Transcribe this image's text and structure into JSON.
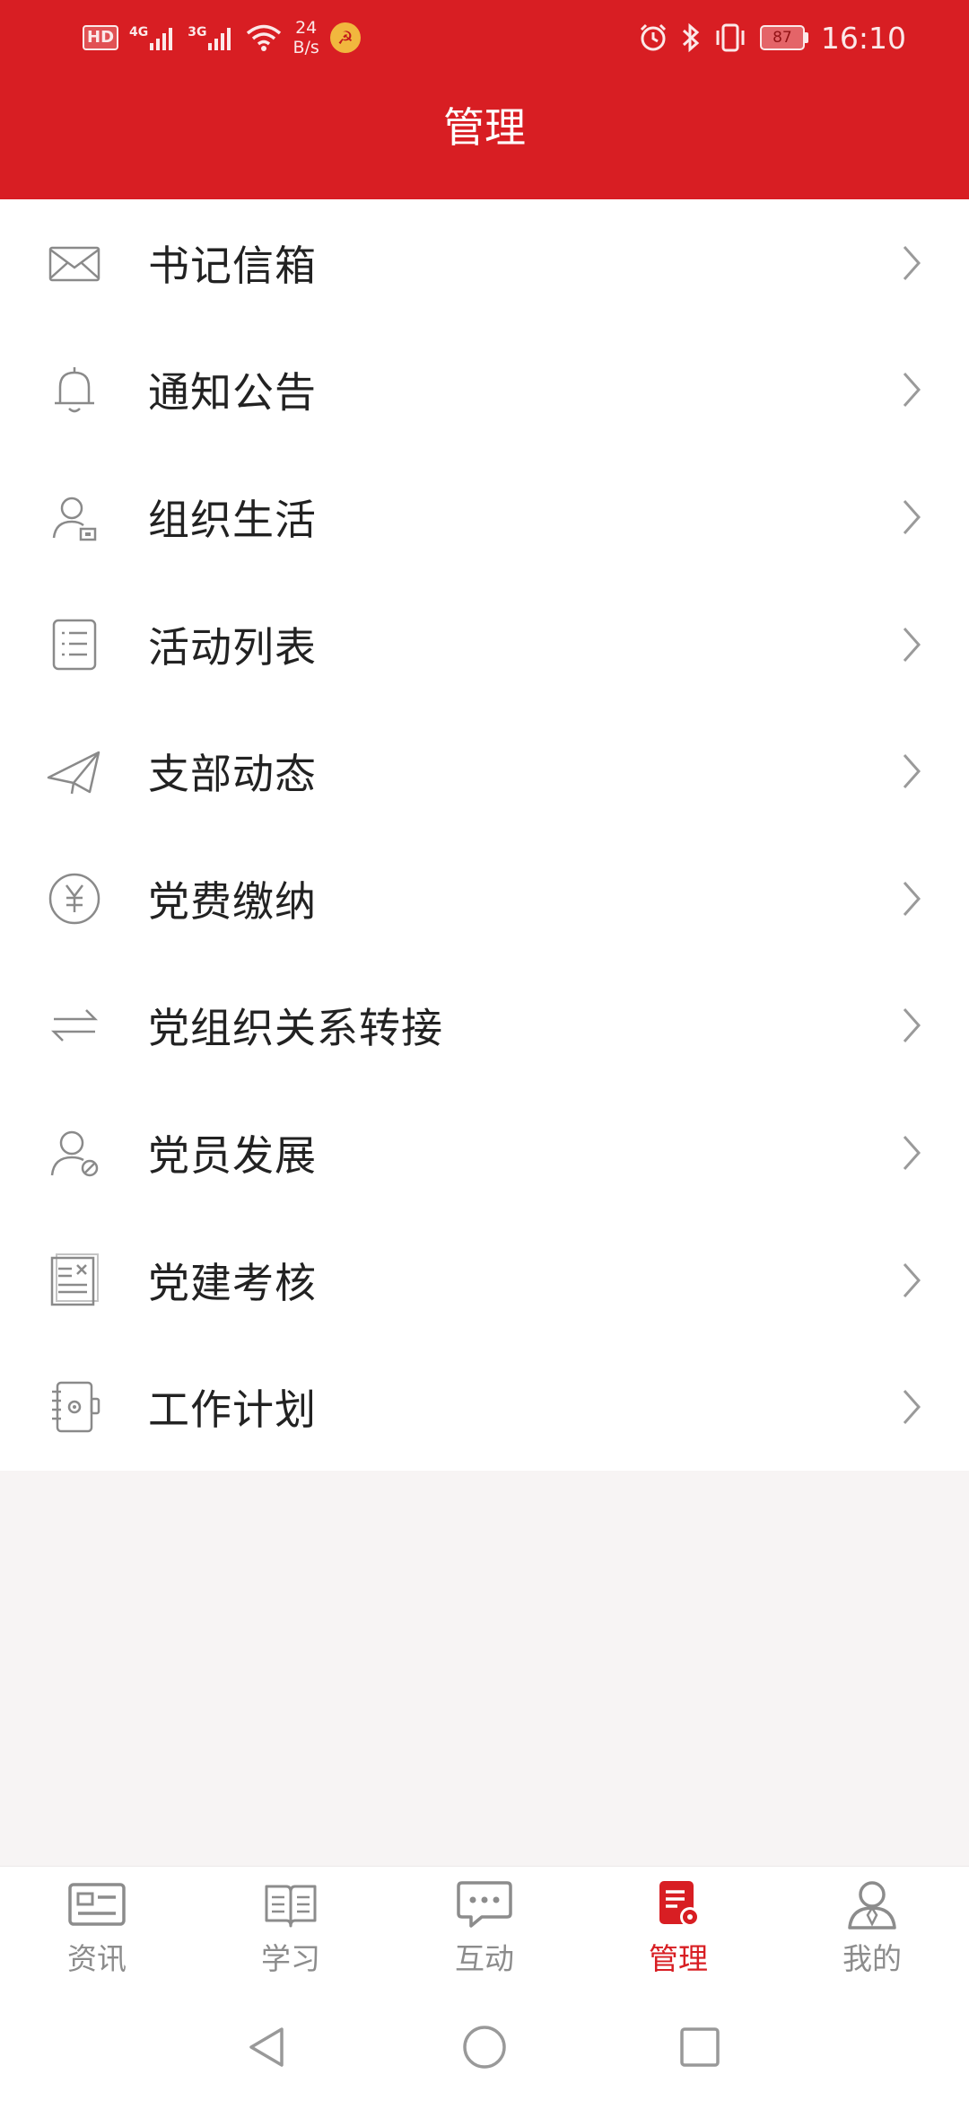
{
  "status_bar": {
    "hd": "HD",
    "net1": "4G",
    "net2": "3G",
    "speed_value": "24",
    "speed_unit": "B/s",
    "battery": "87",
    "time": "16:10"
  },
  "header": {
    "title": "管理"
  },
  "menu": {
    "items": [
      {
        "label": "书记信箱",
        "icon": "mail-icon"
      },
      {
        "label": "通知公告",
        "icon": "bell-icon"
      },
      {
        "label": "组织生活",
        "icon": "user-card-icon"
      },
      {
        "label": "活动列表",
        "icon": "list-icon"
      },
      {
        "label": "支部动态",
        "icon": "paper-plane-icon"
      },
      {
        "label": "党费缴纳",
        "icon": "yuan-coin-icon"
      },
      {
        "label": "党组织关系转接",
        "icon": "transfer-arrows-icon"
      },
      {
        "label": "党员发展",
        "icon": "member-icon"
      },
      {
        "label": "党建考核",
        "icon": "document-review-icon"
      },
      {
        "label": "工作计划",
        "icon": "notebook-icon"
      }
    ]
  },
  "tabs": [
    {
      "label": "资讯",
      "icon": "news-icon"
    },
    {
      "label": "学习",
      "icon": "book-icon"
    },
    {
      "label": "互动",
      "icon": "chat-icon"
    },
    {
      "label": "管理",
      "icon": "manage-icon",
      "active": true
    },
    {
      "label": "我的",
      "icon": "profile-icon"
    }
  ],
  "colors": {
    "brand_red": "#d81e23",
    "icon_gray": "#8a8a8a",
    "text_dark": "#222222",
    "tab_inactive": "#8c8c8c"
  }
}
